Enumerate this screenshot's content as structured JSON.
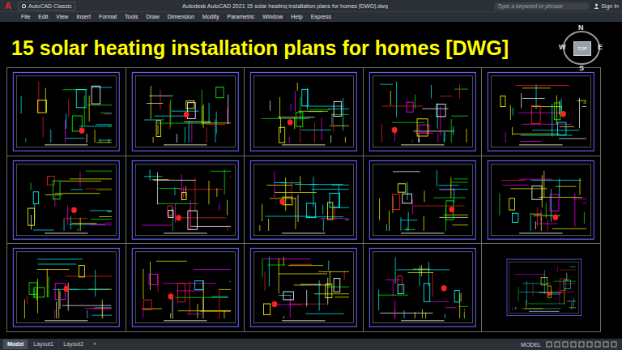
{
  "window": {
    "logo": "A",
    "workspace": "AutoCAD Classic",
    "title": "Autodesk AutoCAD 2021   15 solar heating installation plans for homes [DWG].dwg",
    "search": {
      "placeholder": "Type a keyword or phrase"
    },
    "sign_in": "Sign In"
  },
  "menu": [
    "File",
    "Edit",
    "View",
    "Insert",
    "Format",
    "Tools",
    "Draw",
    "Dimension",
    "Modify",
    "Parametric",
    "Window",
    "Help",
    "Express"
  ],
  "banner": "15 solar heating installation plans for homes [DWG]",
  "viewcube": {
    "north": "N",
    "south": "S",
    "west": "W",
    "east": "E",
    "face": "TOP"
  },
  "sheets": [
    {
      "kind": "full"
    },
    {
      "kind": "full"
    },
    {
      "kind": "full"
    },
    {
      "kind": "full"
    },
    {
      "kind": "full"
    },
    {
      "kind": "full"
    },
    {
      "kind": "full"
    },
    {
      "kind": "full"
    },
    {
      "kind": "full"
    },
    {
      "kind": "full"
    },
    {
      "kind": "full"
    },
    {
      "kind": "full"
    },
    {
      "kind": "full"
    },
    {
      "kind": "full"
    },
    {
      "kind": "inset"
    }
  ],
  "layout_tabs": [
    {
      "label": "Model",
      "selected": true
    },
    {
      "label": "Layout1",
      "selected": false
    },
    {
      "label": "Layout2",
      "selected": false
    }
  ],
  "add_tab": "+",
  "status_bar": {
    "space": "MODEL"
  }
}
